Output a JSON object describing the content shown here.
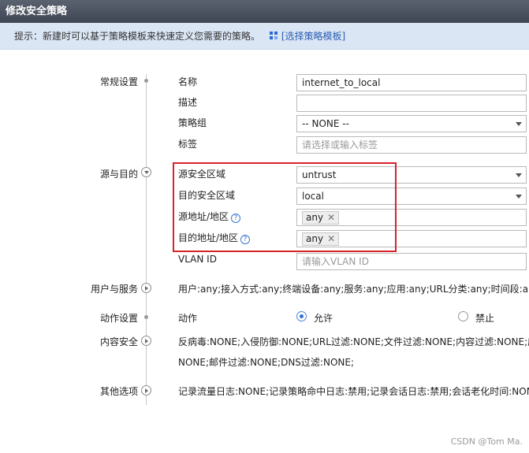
{
  "window": {
    "title": "修改安全策略"
  },
  "hint": {
    "text": "提示：新建时可以基于策略模板来快速定义您需要的策略。",
    "template_link": "[选择策略模板]"
  },
  "sections": {
    "general": "常规设置",
    "src_dst": "源与目的",
    "user_service": "用户与服务",
    "action": "动作设置",
    "content": "内容安全",
    "other": "其他选项"
  },
  "general": {
    "name_label": "名称",
    "name_value": "internet_to_local",
    "desc_label": "描述",
    "desc_value": "",
    "group_label": "策略组",
    "group_value": "-- NONE --",
    "tag_label": "标签",
    "tag_placeholder": "请选择或输入标签"
  },
  "src_dst": {
    "src_zone_label": "源安全区域",
    "src_zone_value": "untrust",
    "dst_zone_label": "目的安全区域",
    "dst_zone_value": "local",
    "src_addr_label": "源地址/地区",
    "src_addr_tag": "any",
    "dst_addr_label": "目的地址/地区",
    "dst_addr_tag": "any",
    "vlan_label": "VLAN ID",
    "vlan_placeholder": "请输入VLAN ID"
  },
  "user_service": {
    "summary": "用户:any;接入方式:any;终端设备:any;服务:any;应用:any;URL分类:any;时间段:any;"
  },
  "action": {
    "label": "动作",
    "allow": "允许",
    "deny": "禁止",
    "selected": "允许"
  },
  "content": {
    "line1": "反病毒:NONE;入侵防御:NONE;URL过滤:NONE;文件过滤:NONE;内容过滤:NONE;应",
    "line2": "NONE;邮件过滤:NONE;DNS过滤:NONE;"
  },
  "other": {
    "summary": "记录流量日志:NONE;记录策略命中日志:禁用;记录会话日志:禁用;会话老化时间:NON"
  },
  "watermark": "CSDN @Tom Ma."
}
